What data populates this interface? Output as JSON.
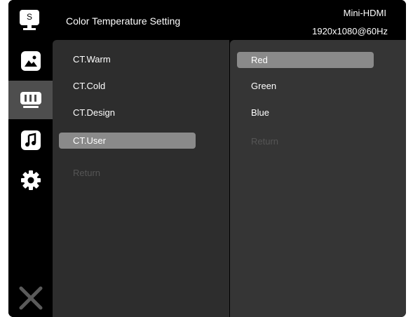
{
  "header": {
    "logo_letter": "S",
    "title": "Color Temperature Setting",
    "source": "Mini-HDMI",
    "resolution": "1920x1080@60Hz"
  },
  "sidebar": {
    "items": [
      {
        "icon": "picture-icon",
        "active": false
      },
      {
        "icon": "display-icon",
        "active": true
      },
      {
        "icon": "music-note-icon",
        "active": false
      },
      {
        "icon": "gear-icon",
        "active": false
      },
      {
        "icon": "close-icon",
        "active": false
      }
    ]
  },
  "middle_menu": {
    "items": [
      {
        "label": "CT.Warm"
      },
      {
        "label": "CT.Cold"
      },
      {
        "label": "CT.Design"
      },
      {
        "label": "CT.User",
        "selected": true
      },
      {
        "label": "Return",
        "disabled": true
      }
    ]
  },
  "right_menu": {
    "items": [
      {
        "label": "Red",
        "selected": true
      },
      {
        "label": "Green"
      },
      {
        "label": "Blue"
      },
      {
        "label": "Return",
        "disabled": true
      }
    ]
  },
  "colors": {
    "highlight": "#8a8a8a",
    "panel": "#2d2d2d",
    "active_sidebar": "#4e4e4e"
  }
}
